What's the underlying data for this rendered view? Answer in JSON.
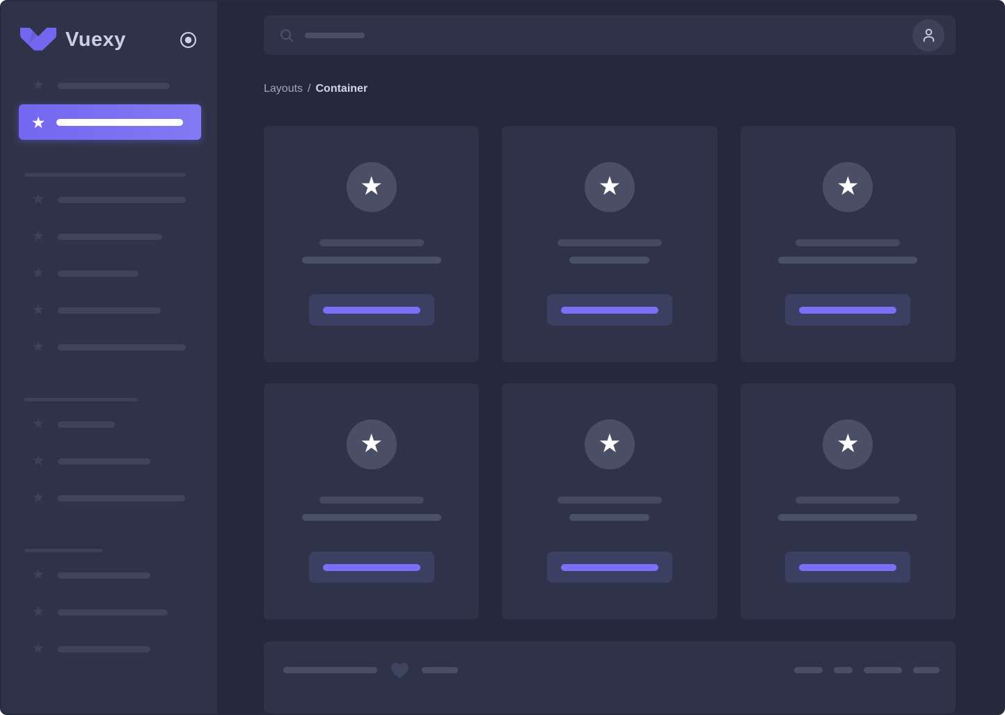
{
  "brand": {
    "name": "Vuexy"
  },
  "breadcrumb": {
    "section": "Layouts",
    "separator": "/",
    "current": "Container"
  },
  "colors": {
    "primary": "#7367f0",
    "background": "#25293c",
    "surface": "#2f3349",
    "text_bright": "#d2d6ea",
    "text_muted": "#a3a7ba"
  },
  "icons": {
    "logo": "vuexy-logo",
    "nav_toggle": "radio-circle",
    "search": "magnifier",
    "avatar": "user-person",
    "menu_item": "star",
    "card_badge": "star",
    "footer_like": "heart"
  }
}
